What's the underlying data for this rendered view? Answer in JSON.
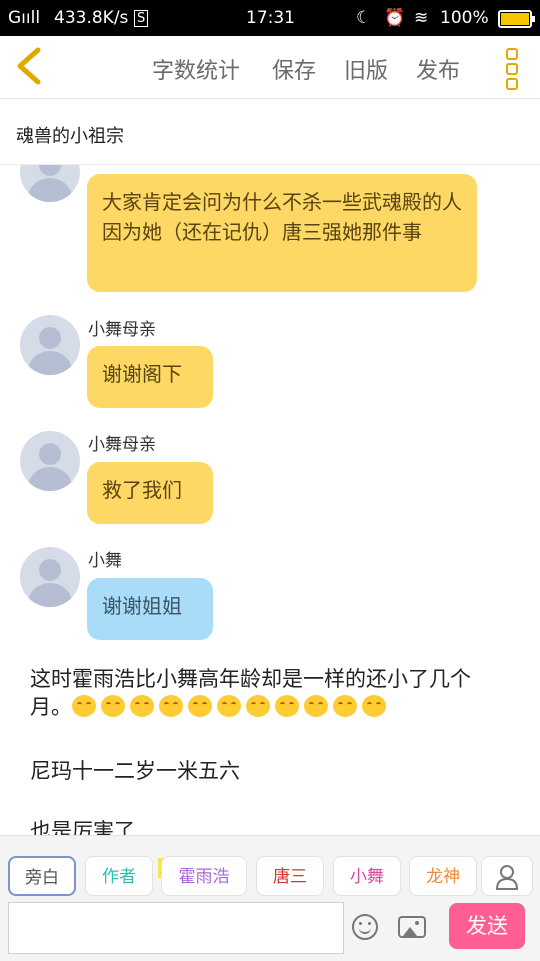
{
  "status_bar": {
    "signal": "Gııll",
    "speed": "433.8K/s",
    "time": "17:31",
    "battery": "100%"
  },
  "toolbar": {
    "word_count": "字数统计",
    "save": "保存",
    "old_version": "旧版",
    "publish": "发布"
  },
  "chat_title": "魂兽的小祖宗",
  "messages": [
    {
      "sender": "",
      "text": "大家肯定会问为什么不杀一些武魂殿的人因为她（还在记仇）唐三强她那件事",
      "color": "yellow"
    },
    {
      "sender": "小舞母亲",
      "text": "谢谢阁下",
      "color": "yellow"
    },
    {
      "sender": "小舞母亲",
      "text": "救了我们",
      "color": "yellow"
    },
    {
      "sender": "小舞",
      "text": "谢谢姐姐",
      "color": "blue"
    }
  ],
  "narration": [
    {
      "text": "这时霍雨浩比小舞高年龄却是一样的还小了几个月。",
      "emoji_count": 11
    },
    {
      "text": "尼玛十一二岁一米五六"
    },
    {
      "text": "也是厉害了"
    }
  ],
  "roles": [
    {
      "label": "旁白",
      "color": "#555555"
    },
    {
      "label": "作者",
      "color": "#2cbfb3"
    },
    {
      "label": "霍雨浩",
      "color": "#a56ad6",
      "badge": "主"
    },
    {
      "label": "唐三",
      "color": "#d63333"
    },
    {
      "label": "小舞",
      "color": "#e0479e"
    },
    {
      "label": "龙神",
      "color": "#f08a3a"
    }
  ],
  "input": {
    "placeholder": ""
  },
  "send_label": "发送",
  "colors": {
    "accent": "#e0a900",
    "bubble_yellow": "#fdd865",
    "bubble_blue": "#a9dcf8",
    "send": "#ff5e95"
  }
}
